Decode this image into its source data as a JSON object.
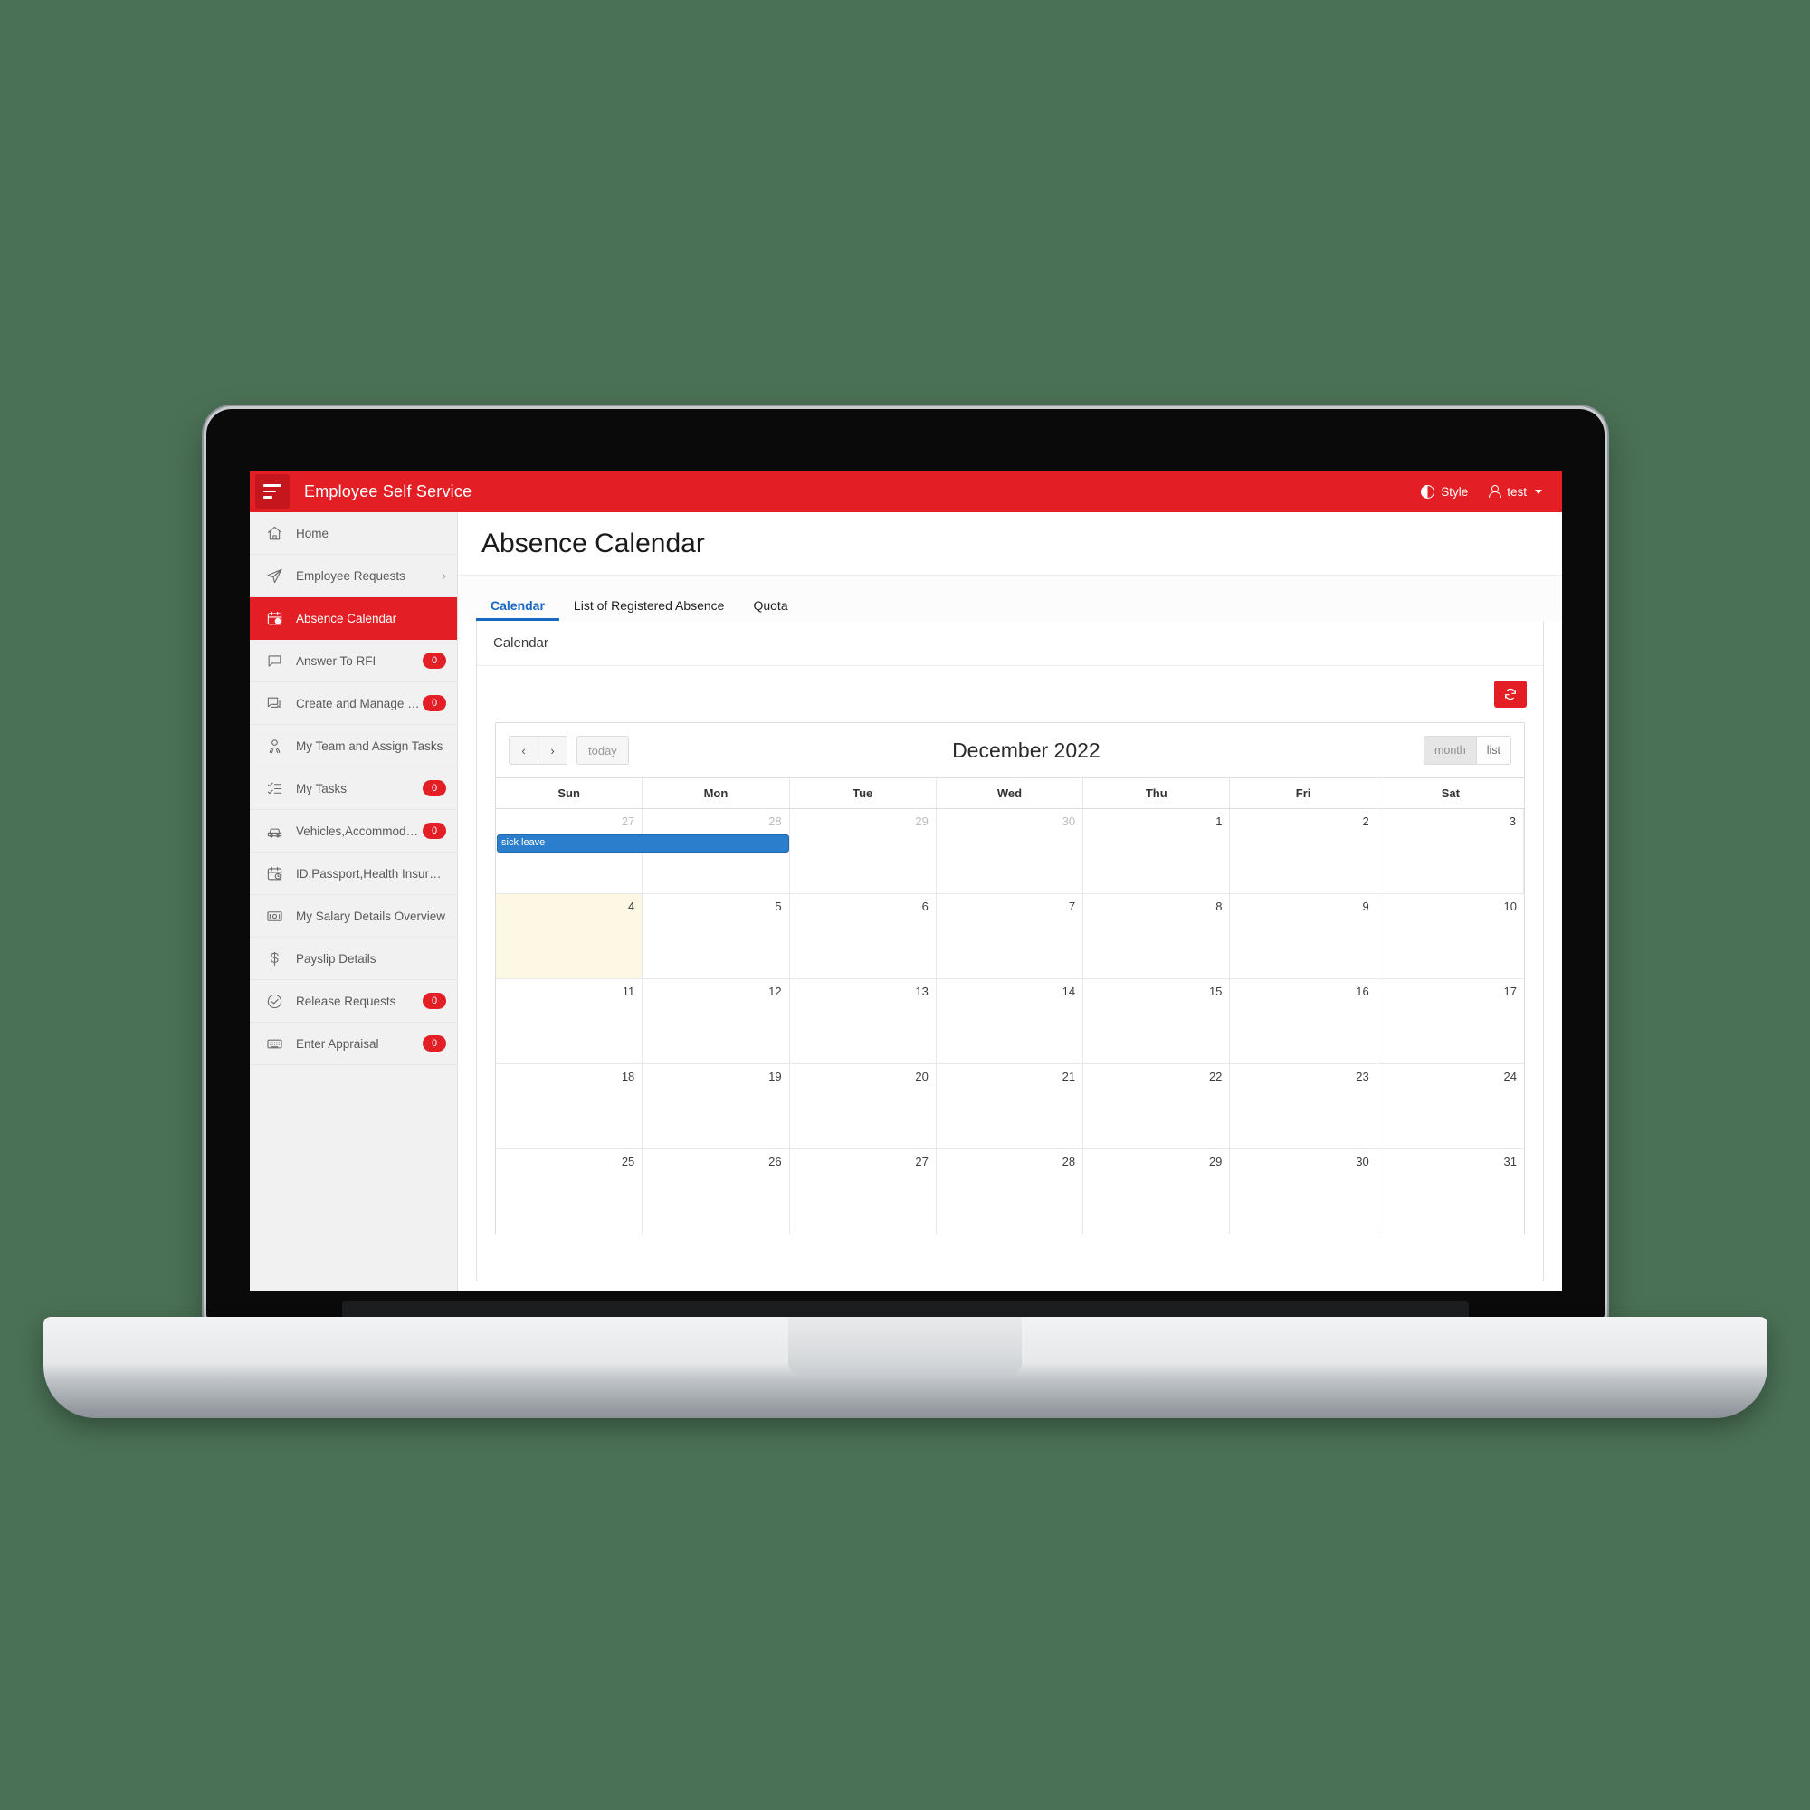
{
  "topbar": {
    "app_title": "Employee Self Service",
    "menu_icon": "hamburger-icon",
    "style_label": "Style",
    "style_icon": "contrast-icon",
    "user_label": "test",
    "user_icon": "user-icon",
    "brand_color": "#e31e24"
  },
  "sidebar": {
    "items": [
      {
        "label": "Home",
        "icon": "home-icon",
        "badge": null,
        "chevron": false,
        "active": false
      },
      {
        "label": "Employee Requests",
        "icon": "send-icon",
        "badge": null,
        "chevron": true,
        "active": false
      },
      {
        "label": "Absence Calendar",
        "icon": "calendar-clock-icon",
        "badge": null,
        "chevron": false,
        "active": true
      },
      {
        "label": "Answer To RFI",
        "icon": "chat-bubble-icon",
        "badge": "0",
        "chevron": false,
        "active": false
      },
      {
        "label": "Create and Manage RFI",
        "icon": "chat-bubbles-icon",
        "badge": "0",
        "chevron": false,
        "active": false
      },
      {
        "label": "My Team and Assign Tasks",
        "icon": "users-icon",
        "badge": null,
        "chevron": false,
        "active": false
      },
      {
        "label": "My Tasks",
        "icon": "checklist-icon",
        "badge": "0",
        "chevron": false,
        "active": false
      },
      {
        "label": "Vehicles,Accommodation a...",
        "icon": "car-icon",
        "badge": "0",
        "chevron": false,
        "active": false
      },
      {
        "label": "ID,Passport,Health Insuracne...",
        "icon": "calendar-clock-icon",
        "badge": null,
        "chevron": false,
        "active": false
      },
      {
        "label": "My Salary Details Overview",
        "icon": "banknote-icon",
        "badge": null,
        "chevron": false,
        "active": false
      },
      {
        "label": "Payslip Details",
        "icon": "dollar-icon",
        "badge": null,
        "chevron": false,
        "active": false
      },
      {
        "label": "Release Requests",
        "icon": "check-circle-icon",
        "badge": "0",
        "chevron": false,
        "active": false
      },
      {
        "label": "Enter Appraisal",
        "icon": "keyboard-icon",
        "badge": "0",
        "chevron": false,
        "active": false
      }
    ]
  },
  "page": {
    "title": "Absence Calendar",
    "tabs": [
      {
        "label": "Calendar",
        "active": true
      },
      {
        "label": "List of Registered Absence",
        "active": false
      },
      {
        "label": "Quota",
        "active": false
      }
    ],
    "panel_title": "Calendar",
    "refresh_icon": "refresh-icon"
  },
  "calendar": {
    "prev_label": "‹",
    "next_label": "›",
    "today_label": "today",
    "title": "December 2022",
    "view_buttons": [
      {
        "label": "month",
        "active": true
      },
      {
        "label": "list",
        "active": false
      }
    ],
    "day_headers": [
      "Sun",
      "Mon",
      "Tue",
      "Wed",
      "Thu",
      "Fri",
      "Sat"
    ],
    "weeks": [
      [
        {
          "num": "27",
          "other": true,
          "today": false
        },
        {
          "num": "28",
          "other": true,
          "today": false
        },
        {
          "num": "29",
          "other": true,
          "today": false
        },
        {
          "num": "30",
          "other": true,
          "today": false
        },
        {
          "num": "1",
          "other": false,
          "today": false
        },
        {
          "num": "2",
          "other": false,
          "today": false
        },
        {
          "num": "3",
          "other": false,
          "today": false
        }
      ],
      [
        {
          "num": "4",
          "other": false,
          "today": true
        },
        {
          "num": "5",
          "other": false,
          "today": false
        },
        {
          "num": "6",
          "other": false,
          "today": false
        },
        {
          "num": "7",
          "other": false,
          "today": false
        },
        {
          "num": "8",
          "other": false,
          "today": false
        },
        {
          "num": "9",
          "other": false,
          "today": false
        },
        {
          "num": "10",
          "other": false,
          "today": false
        }
      ],
      [
        {
          "num": "11",
          "other": false,
          "today": false
        },
        {
          "num": "12",
          "other": false,
          "today": false
        },
        {
          "num": "13",
          "other": false,
          "today": false
        },
        {
          "num": "14",
          "other": false,
          "today": false
        },
        {
          "num": "15",
          "other": false,
          "today": false
        },
        {
          "num": "16",
          "other": false,
          "today": false
        },
        {
          "num": "17",
          "other": false,
          "today": false
        }
      ],
      [
        {
          "num": "18",
          "other": false,
          "today": false
        },
        {
          "num": "19",
          "other": false,
          "today": false
        },
        {
          "num": "20",
          "other": false,
          "today": false
        },
        {
          "num": "21",
          "other": false,
          "today": false
        },
        {
          "num": "22",
          "other": false,
          "today": false
        },
        {
          "num": "23",
          "other": false,
          "today": false
        },
        {
          "num": "24",
          "other": false,
          "today": false
        }
      ],
      [
        {
          "num": "25",
          "other": false,
          "today": false
        },
        {
          "num": "26",
          "other": false,
          "today": false
        },
        {
          "num": "27",
          "other": false,
          "today": false
        },
        {
          "num": "28",
          "other": false,
          "today": false
        },
        {
          "num": "29",
          "other": false,
          "today": false
        },
        {
          "num": "30",
          "other": false,
          "today": false
        },
        {
          "num": "31",
          "other": false,
          "today": false
        }
      ]
    ],
    "events": [
      {
        "title": "sick leave",
        "week": 0,
        "start_col": 0,
        "span": 2,
        "color": "#2b7ecb"
      }
    ]
  }
}
